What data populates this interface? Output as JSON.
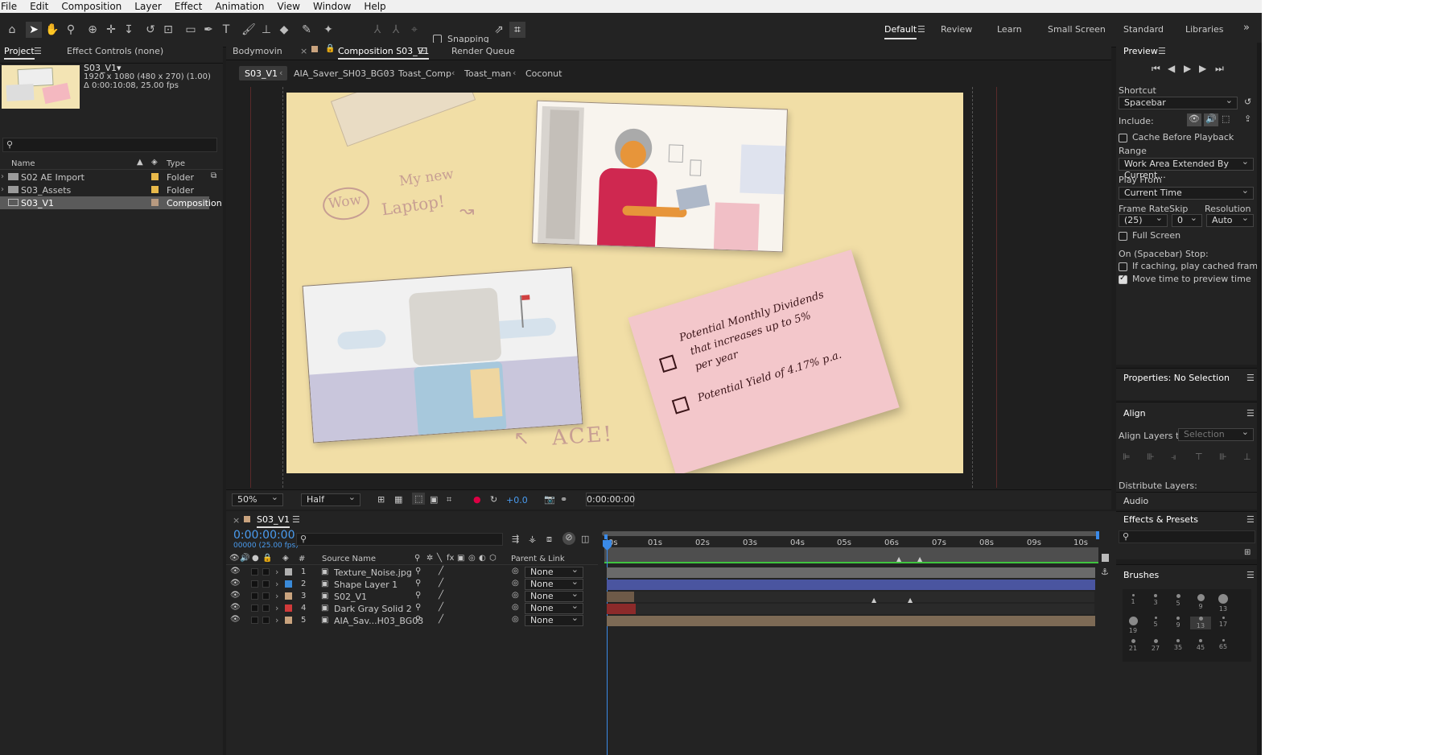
{
  "menu": [
    "File",
    "Edit",
    "Composition",
    "Layer",
    "Effect",
    "Animation",
    "View",
    "Window",
    "Help"
  ],
  "toolbar": {
    "snapping_label": "Snapping"
  },
  "workspaces": [
    "Default",
    "Review",
    "Learn",
    "Small Screen",
    "Standard",
    "Libraries"
  ],
  "project_panel": {
    "tabs": [
      "Project",
      "Effect Controls (none)"
    ],
    "selected_name": "S03_V1▾",
    "selected_size": "1920 x 1080  (480 x 270) (1.00)",
    "selected_duration": "Δ 0:00:10:08, 25.00 fps",
    "columns": {
      "name": "Name",
      "type": "Type"
    },
    "items": [
      {
        "name": "S02 AE Import",
        "type": "Folder",
        "color": "#e8b94a"
      },
      {
        "name": "S03_Assets",
        "type": "Folder",
        "color": "#e8b94a"
      },
      {
        "name": "S03_V1",
        "type": "Composition",
        "color": "#b89a80"
      }
    ]
  },
  "comp_panel": {
    "tabs": [
      "Bodymovin",
      "Composition S03_V1",
      "Render Queue"
    ],
    "breadcrumbs": [
      "S03_V1",
      "AIA_Saver_SH03_BG03",
      "Toast_Comp",
      "Toast_man",
      "Coconut"
    ],
    "artwork_text": {
      "wow": "Wow",
      "my_new": "My new",
      "laptop": "Laptop!",
      "ace": "ACE!",
      "note_line1": "Potential Monthly Dividends",
      "note_line2": "that increases up to 5%",
      "note_line3": "per year",
      "note_line4": "Potential Yield of 4.17% p.a."
    },
    "zoom": "50%",
    "resolution": "Half",
    "exposure": "+0.0",
    "current_time": "0:00:00:00"
  },
  "timeline": {
    "comp_name": "S03_V1",
    "timecode": "0:00:00:00",
    "timecode_sub": "00000 (25.00 fps)",
    "col_source": "Source Name",
    "col_parent": "Parent & Link",
    "ruler": [
      "0s",
      "01s",
      "02s",
      "03s",
      "04s",
      "05s",
      "06s",
      "07s",
      "08s",
      "09s",
      "10s"
    ],
    "layers": [
      {
        "num": "1",
        "name": "Texture_Noise.jpg",
        "label_color": "#b0b0b0",
        "parent": "None",
        "bar_color": "#6a6a6a"
      },
      {
        "num": "2",
        "name": "Shape Layer 1",
        "label_color": "#3a8ad8",
        "parent": "None",
        "bar_color": "#4a55a0"
      },
      {
        "num": "3",
        "name": "S02_V1",
        "label_color": "#c9a37e",
        "parent": "None",
        "bar_color": "#6e5a48"
      },
      {
        "num": "4",
        "name": "Dark Gray Solid 2",
        "label_color": "#d03a3a",
        "parent": "None",
        "bar_color": "#8c2a2a"
      },
      {
        "num": "5",
        "name": "AIA_Sav...H03_BG03",
        "label_color": "#c9a37e",
        "parent": "None",
        "bar_color": "#7d6a55"
      }
    ]
  },
  "preview": {
    "title": "Preview",
    "shortcut_label": "Shortcut",
    "shortcut_value": "Spacebar",
    "include_label": "Include:",
    "cache_label": "Cache Before Playback",
    "range_label": "Range",
    "range_value": "Work Area Extended By Current...",
    "play_from_label": "Play From",
    "play_from_value": "Current Time",
    "frame_rate_label": "Frame Rate",
    "skip_label": "Skip",
    "resolution_label": "Resolution",
    "frame_rate_value": "(25)",
    "skip_value": "0",
    "resolution_value": "Auto",
    "full_screen_label": "Full Screen",
    "stop_label": "On (Spacebar) Stop:",
    "if_caching_label": "If caching, play cached frames",
    "move_time_label": "Move time to preview time"
  },
  "right_panels": {
    "properties": "Properties: No Selection",
    "align": "Align",
    "align_to_label": "Align Layers to:",
    "align_to_value": "Selection",
    "distribute": "Distribute Layers:",
    "audio": "Audio",
    "effects": "Effects & Presets",
    "brushes": "Brushes",
    "brush_sizes": [
      "1",
      "3",
      "5",
      "9",
      "13",
      "19",
      "5",
      "9",
      "13",
      "17",
      "21",
      "27",
      "35",
      "45",
      "65"
    ]
  }
}
